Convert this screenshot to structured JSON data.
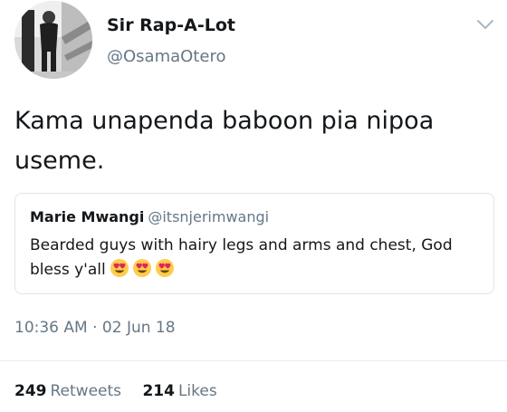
{
  "author": {
    "display_name": "Sir Rap-A-Lot",
    "handle": "@OsamaOtero",
    "avatar_icon": "profile-photo"
  },
  "tweet": {
    "text": "Kama unapenda baboon pia nipoa useme."
  },
  "quoted_tweet": {
    "display_name": "Marie Mwangi",
    "handle": "@itsnjerimwangi",
    "text": "Bearded guys with hairy legs and arms and chest, God bless y'all",
    "emojis": [
      "heart-eyes-emoji",
      "heart-eyes-emoji",
      "heart-eyes-emoji"
    ]
  },
  "meta": {
    "time": "10:36 AM",
    "separator": "·",
    "date": "02 Jun 18"
  },
  "stats": {
    "retweets_count": "249",
    "retweets_label": "Retweets",
    "likes_count": "214",
    "likes_label": "Likes"
  },
  "colors": {
    "text_primary": "#14171a",
    "text_secondary": "#657786",
    "border": "#dfe4e8",
    "emoji_face": "#ffcc4d",
    "emoji_heart": "#e0245e"
  },
  "icons": {
    "more_menu": "chevron-down-icon"
  }
}
